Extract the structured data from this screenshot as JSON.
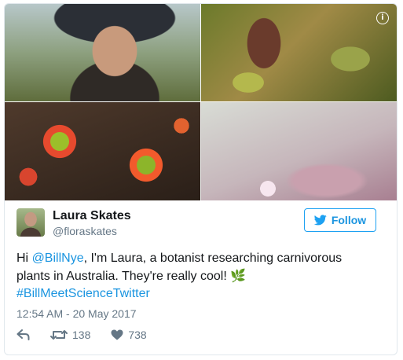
{
  "media": {
    "photos": [
      {
        "subject": "Laura smiling outdoors in a hat"
      },
      {
        "subject": "carnivorous pitcher plants"
      },
      {
        "subject": "red sundew plants"
      },
      {
        "subject": "pink sundew flowers"
      }
    ],
    "info_icon": "info-icon"
  },
  "author": {
    "name": "Laura Skates",
    "handle": "@floraskates"
  },
  "follow_button": {
    "label": "Follow",
    "icon": "twitter-bird-icon"
  },
  "tweet": {
    "prefix": "Hi ",
    "mention": "@BillNye",
    "middle": ", I'm Laura, a botanist researching carnivorous plants in Australia. They're really cool! ",
    "emoji": "🌿",
    "hashtag": "#BillMeetScienceTwitter"
  },
  "timestamp": "12:54 AM - 20 May 2017",
  "actions": {
    "reply_icon": "reply-icon",
    "retweet_icon": "retweet-icon",
    "retweet_count": "138",
    "like_icon": "heart-icon",
    "like_count": "738"
  },
  "colors": {
    "accent": "#1da1f2",
    "link": "#1b95e0",
    "text": "#14171a",
    "muted": "#657786",
    "border": "#e1e8ed"
  }
}
